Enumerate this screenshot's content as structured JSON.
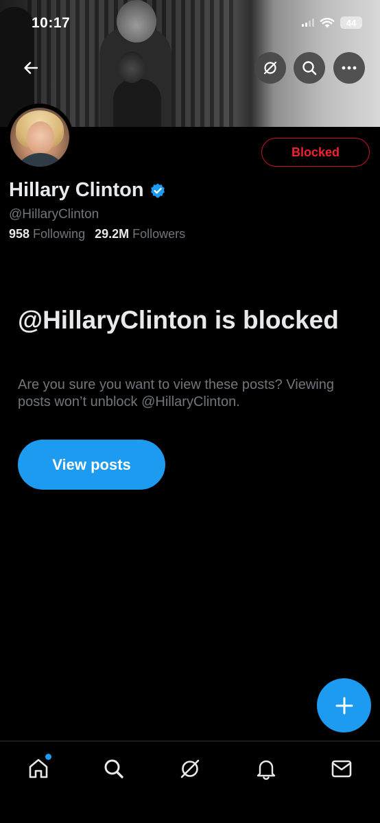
{
  "status_bar": {
    "time": "10:17",
    "battery": "44"
  },
  "header": {
    "icons": [
      "back-arrow-icon",
      "grok-icon",
      "search-icon",
      "more-icon"
    ]
  },
  "profile": {
    "display_name": "Hillary Clinton",
    "verified": true,
    "handle": "@HillaryClinton",
    "following_count": "958",
    "following_label": "Following",
    "followers_count": "29.2M",
    "followers_label": "Followers",
    "blocked_button_label": "Blocked"
  },
  "blocked_notice": {
    "title": "@HillaryClinton is blocked",
    "description": "Are you sure you want to view these posts? Viewing posts won’t unblock @HillaryClinton.",
    "view_posts_label": "View posts"
  },
  "bottom_nav": {
    "items": [
      "home-icon",
      "search-icon",
      "grok-icon",
      "notifications-icon",
      "messages-icon"
    ],
    "home_has_notification_dot": true
  },
  "colors": {
    "accent": "#1d9bf0",
    "blocked_red": "#f4212e",
    "secondary_text": "#71767b",
    "primary_text": "#e7e9ea",
    "background": "#000000"
  }
}
